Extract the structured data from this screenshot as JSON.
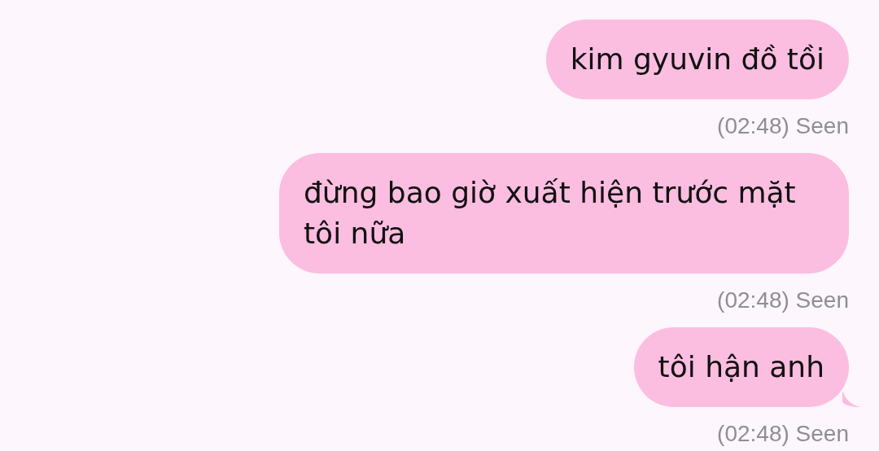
{
  "messages": [
    {
      "text": "kim gyuvin đồ tồi",
      "receipt": "(02:48) Seen",
      "tail": false
    },
    {
      "text": "đừng bao giờ xuất hiện trước mặt tôi nữa",
      "receipt": "(02:48) Seen",
      "tail": false
    },
    {
      "text": "tôi hận anh",
      "receipt": "(02:48) Seen",
      "tail": true
    }
  ]
}
